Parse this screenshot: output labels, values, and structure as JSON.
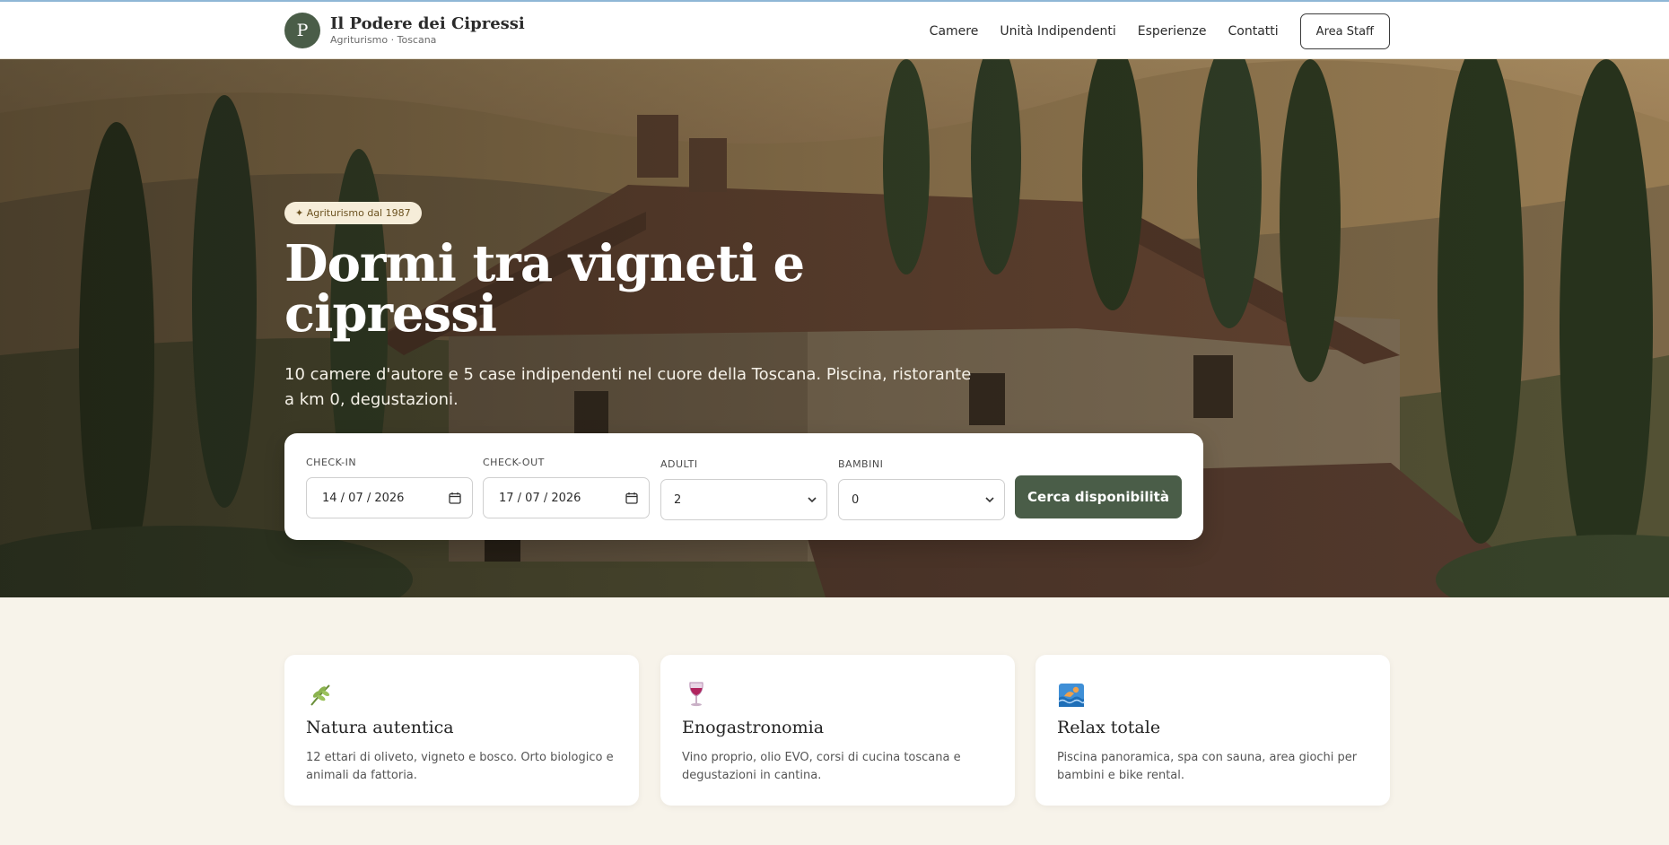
{
  "header": {
    "logo_letter": "P",
    "name": "Il Podere dei Cipressi",
    "subtitle": "Agriturismo · Toscana",
    "nav": [
      "Camere",
      "Unità Indipendenti",
      "Esperienze",
      "Contatti"
    ],
    "staff_label": "Area Staff"
  },
  "hero": {
    "badge": "✦ Agriturismo dal 1987",
    "title": "Dormi tra vigneti e cipressi",
    "description": "10 camere d'autore e 5 case indipendenti nel cuore della Toscana. Piscina, ristorante a km 0, degustazioni."
  },
  "booking": {
    "checkin_label": "CHECK-IN",
    "checkin_value": "14 / 07 / 2026",
    "checkout_label": "CHECK-OUT",
    "checkout_value": "17 / 07 / 2026",
    "adults_label": "ADULTI",
    "adults_value": "2",
    "children_label": "BAMBINI",
    "children_value": "0",
    "search_label": "Cerca disponibilità"
  },
  "features": [
    {
      "icon": "herb-icon",
      "title": "Natura autentica",
      "text": "12 ettari di oliveto, vigneto e bosco. Orto biologico e animali da fattoria."
    },
    {
      "icon": "wine-glass-icon",
      "title": "Enogastronomia",
      "text": "Vino proprio, olio EVO, corsi di cucina toscana e degustazioni in cantina."
    },
    {
      "icon": "swimmer-icon",
      "title": "Relax totale",
      "text": "Piscina panoramica, spa con sauna, area giochi per bambini e bike rental."
    }
  ],
  "colors": {
    "brand": "#4a5d48",
    "badge_bg": "#f6edd9",
    "page_bg": "#f7f3ea"
  }
}
